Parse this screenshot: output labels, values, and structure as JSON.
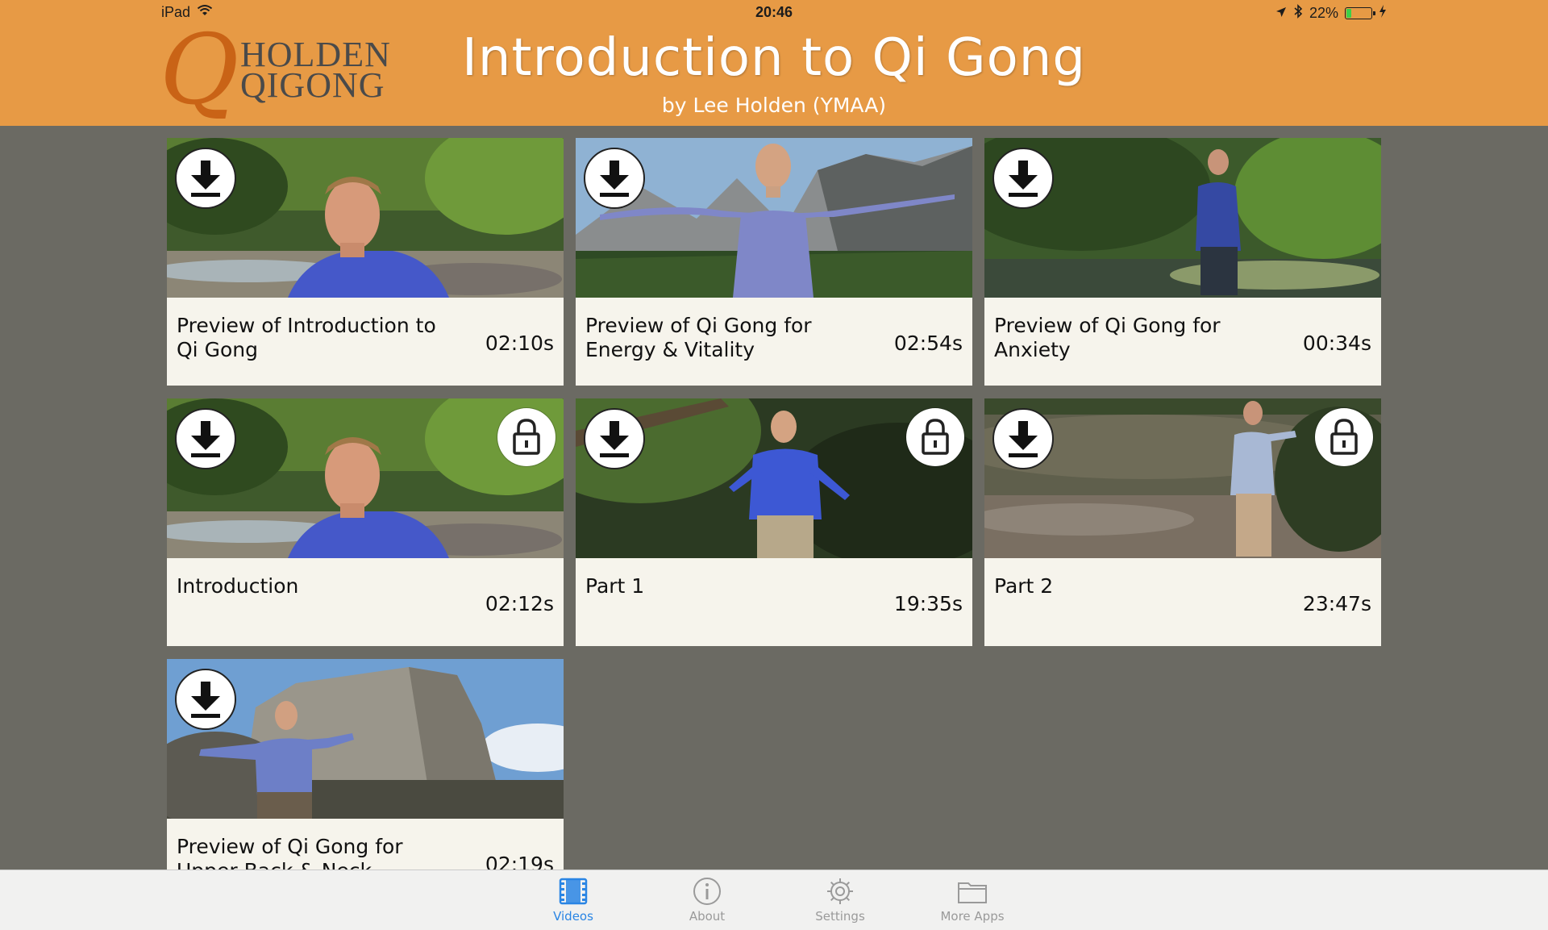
{
  "status_bar": {
    "device": "iPad",
    "time": "20:46",
    "battery": "22%",
    "battery_level": 0.22,
    "battery_color": "#3bd04a"
  },
  "header": {
    "logo_line1": "HOLDEN",
    "logo_line2": "QIGONG",
    "title": "Introduction to Qi Gong",
    "subtitle": "by Lee Holden (YMAA)",
    "background": "#e79a45"
  },
  "videos": [
    {
      "title": "Preview of Introduction to Qi Gong",
      "duration": "02:10s",
      "locked": false,
      "scene": "forest-creek-closeup"
    },
    {
      "title": "Preview of Qi Gong for Energy & Vitality",
      "duration": "02:54s",
      "locked": false,
      "scene": "mountain-valley-arms-wide"
    },
    {
      "title": "Preview of Qi Gong for Anxiety",
      "duration": "00:34s",
      "locked": false,
      "scene": "forest-creek-standing"
    },
    {
      "title": "Introduction",
      "duration": "02:12s",
      "locked": true,
      "scene": "forest-creek-closeup"
    },
    {
      "title": "Part 1",
      "duration": "19:35s",
      "locked": true,
      "scene": "dark-forest-arms-out"
    },
    {
      "title": "Part 2",
      "duration": "23:47s",
      "locked": true,
      "scene": "river-bank-standing"
    },
    {
      "title": "Preview of Qi Gong for Upper Back & Neck",
      "duration": "02:19s",
      "locked": false,
      "scene": "granite-cliff-arms-out"
    }
  ],
  "icons": {
    "download": "download-icon",
    "lock": "lock-icon"
  },
  "tabbar": {
    "active_color": "#2a85e4",
    "tabs": [
      {
        "label": "Videos",
        "icon": "film-icon",
        "active": true
      },
      {
        "label": "About",
        "icon": "info-icon",
        "active": false
      },
      {
        "label": "Settings",
        "icon": "gear-icon",
        "active": false
      },
      {
        "label": "More Apps",
        "icon": "folder-icon",
        "active": false
      }
    ]
  }
}
